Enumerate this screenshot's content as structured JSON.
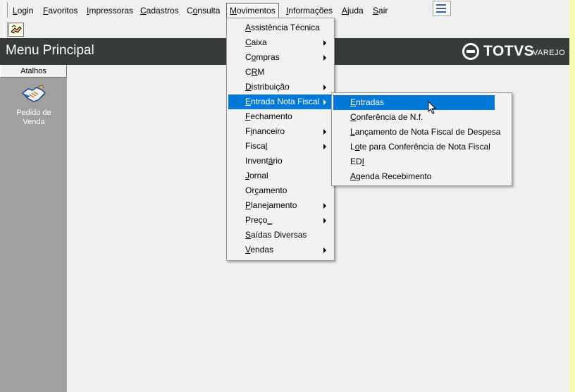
{
  "menubar": {
    "items": [
      {
        "pre": "",
        "u": "L",
        "post": "ogin"
      },
      {
        "pre": "",
        "u": "F",
        "post": "avoritos"
      },
      {
        "pre": "",
        "u": "I",
        "post": "mpressoras"
      },
      {
        "pre": "",
        "u": "C",
        "post": "adastros"
      },
      {
        "pre": "C",
        "u": "o",
        "post": "nsulta"
      },
      {
        "pre": "",
        "u": "M",
        "post": "ovimentos"
      },
      {
        "pre": "",
        "u": "I",
        "post": "nformações"
      },
      {
        "pre": "",
        "u": "A",
        "post": "juda"
      },
      {
        "pre": "",
        "u": "S",
        "post": "air"
      }
    ]
  },
  "header": {
    "title": "Menu Principal",
    "logo_text": "TOTVS",
    "logo_sub": "VAREJO"
  },
  "sidebar": {
    "heading": "Atalhos",
    "shortcut_line1": "Pedido de",
    "shortcut_line2": "Venda"
  },
  "movimentos_menu": [
    {
      "pre": "",
      "u": "A",
      "post": "ssistência Técnica",
      "sub": false
    },
    {
      "pre": "",
      "u": "C",
      "post": "aixa",
      "sub": true
    },
    {
      "pre": "C",
      "u": "o",
      "post": "mpras",
      "sub": true
    },
    {
      "pre": "C",
      "u": "R",
      "post": "M",
      "sub": false
    },
    {
      "pre": "",
      "u": "D",
      "post": "istribuição",
      "sub": true
    },
    {
      "pre": "",
      "u": "E",
      "post": "ntrada Nota Fiscal",
      "sub": true
    },
    {
      "pre": "",
      "u": "F",
      "post": "echamento",
      "sub": false
    },
    {
      "pre": "F",
      "u": "i",
      "post": "nanceiro",
      "sub": true
    },
    {
      "pre": "Fisca",
      "u": "l",
      "post": "",
      "sub": true
    },
    {
      "pre": "Invent",
      "u": "á",
      "post": "rio",
      "sub": false
    },
    {
      "pre": "",
      "u": "J",
      "post": "ornal",
      "sub": false
    },
    {
      "pre": "Or",
      "u": "ç",
      "post": "amento",
      "sub": false
    },
    {
      "pre": "",
      "u": "P",
      "post": "lanejamento",
      "sub": true
    },
    {
      "pre": "Preço",
      "u": "_",
      "post": "",
      "sub": true
    },
    {
      "pre": "",
      "u": "S",
      "post": "aídas Diversas",
      "sub": false
    },
    {
      "pre": "",
      "u": "V",
      "post": "endas",
      "sub": true
    }
  ],
  "entrada_menu": [
    {
      "pre": "",
      "u": "E",
      "post": "ntradas"
    },
    {
      "pre": "",
      "u": "C",
      "post": "onferência de N.f."
    },
    {
      "pre": "",
      "u": "L",
      "post": "ançamento de Nota Fiscal de Despesa"
    },
    {
      "pre": "L",
      "u": "o",
      "post": "te para Conferência de Nota Fiscal"
    },
    {
      "pre": "ED",
      "u": "I",
      "post": ""
    },
    {
      "pre": "",
      "u": "A",
      "post": "genda Recebimento"
    }
  ],
  "colors": {
    "header_bg": "#363b3c",
    "sidebar_bg": "#a0a0a0",
    "highlight": "#0078d7",
    "right_strip": "#f4f9b4"
  }
}
